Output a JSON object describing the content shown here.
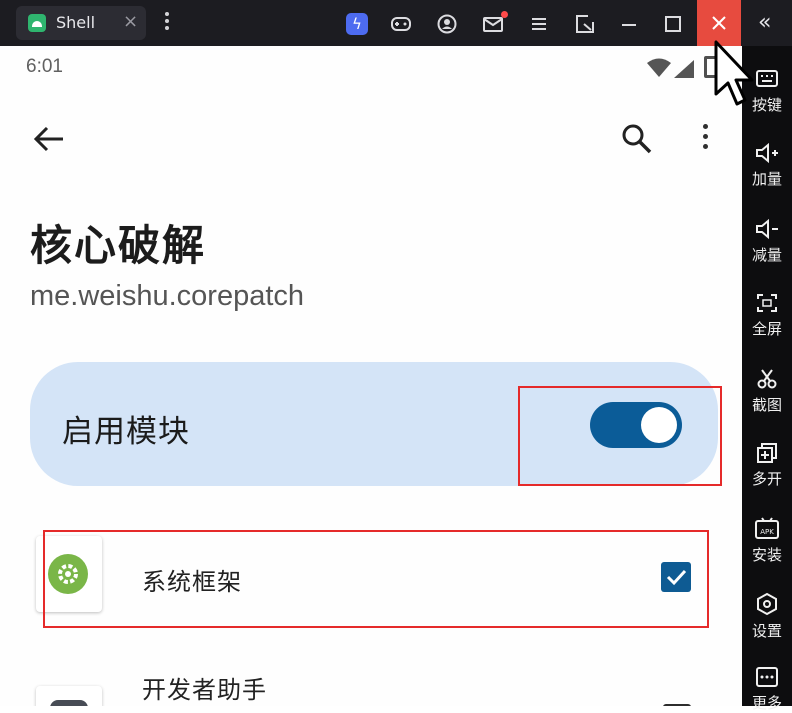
{
  "window": {
    "tab_title": "Shell",
    "tab_close": "×",
    "collapse": "«",
    "bolt": "ϟ"
  },
  "status_bar": {
    "time": "6:01"
  },
  "app": {
    "title": "核心破解",
    "package": "me.weishu.corepatch",
    "enable_label": "启用模块",
    "enabled": true
  },
  "scope_list": [
    {
      "label": "系统框架",
      "checked": true
    },
    {
      "label": "开发者助手",
      "checked": false
    }
  ],
  "sidebar": {
    "items": [
      {
        "label": "按键",
        "icon": "keyboard-icon"
      },
      {
        "label": "加量",
        "icon": "volume-up-icon"
      },
      {
        "label": "减量",
        "icon": "volume-down-icon"
      },
      {
        "label": "全屏",
        "icon": "fullscreen-icon"
      },
      {
        "label": "截图",
        "icon": "scissors-icon"
      },
      {
        "label": "多开",
        "icon": "multi-instance-icon"
      },
      {
        "label": "安装",
        "icon": "apk-install-icon"
      },
      {
        "label": "设置",
        "icon": "settings-hexagon-icon"
      },
      {
        "label": "更多",
        "icon": "more-icon"
      }
    ]
  },
  "colors": {
    "accent": "#0b5c98",
    "card": "#d4e4f7",
    "close_button": "#e74b3f",
    "highlight": "#e52a2a"
  }
}
